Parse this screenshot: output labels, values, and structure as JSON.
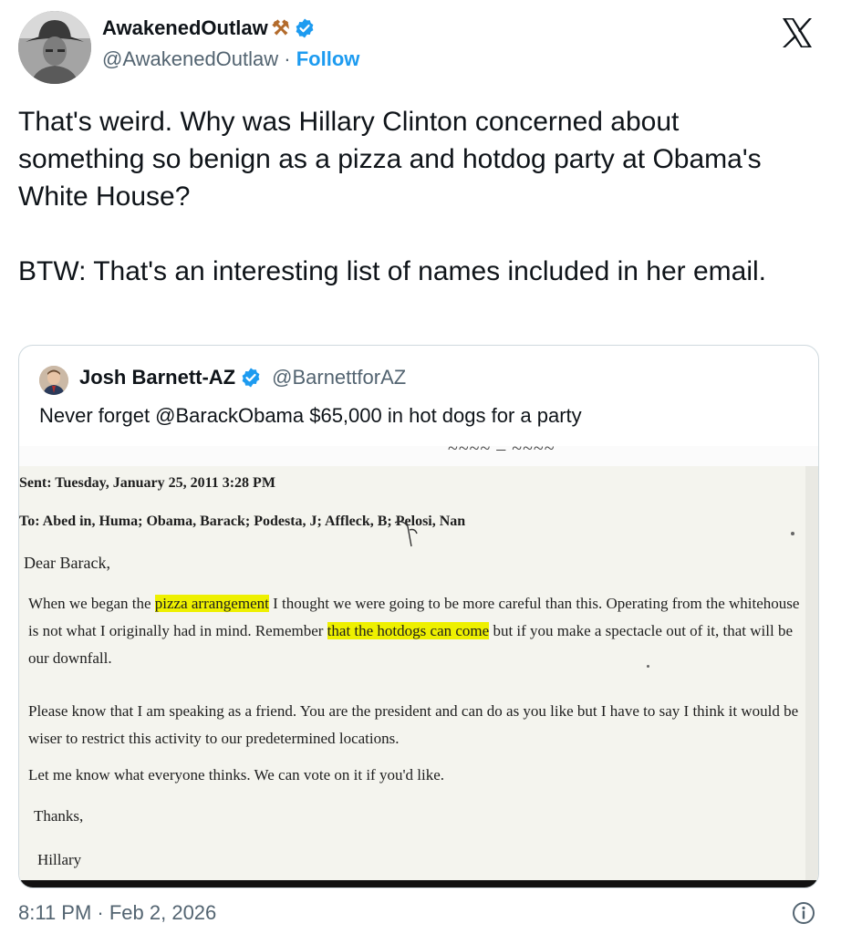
{
  "author": {
    "display_name": "AwakenedOutlaw",
    "name_emoji": "⚒",
    "handle": "@AwakenedOutlaw",
    "separator": "·",
    "follow_label": "Follow",
    "verified_color": "#1d9bf0"
  },
  "tweet": {
    "text": "That's weird.  Why was Hillary Clinton concerned about something so benign as a pizza and hotdog party at Obama's White House?\n\nBTW: That's an interesting list of names included in her email.",
    "timestamp": "8:11 PM · Feb 2, 2026"
  },
  "quote": {
    "display_name": "Josh Barnett-AZ",
    "handle": "@BarnettforAZ",
    "text": "Never forget @BarackObama $65,000 in hot dogs for a party"
  },
  "email": {
    "top_fragment": "~~~~  – ~~~~",
    "sent": "Sent: Tuesday, January 25, 2011 3:28 PM",
    "to": "To: Abed in, Huma; Obama, Barack; Podesta, J; Affleck, B; Pelosi, Nan",
    "greeting": "Dear Barack,",
    "p1_a": "When we began the ",
    "p1_hl1": "pizza arrangement",
    "p1_b": " I thought we were going to be more careful than this. Operating from the whitehouse is not what I originally had in mind. Remember ",
    "p1_hl2": "that the hotdogs can come",
    "p1_c": " but if you make a spectacle out of it, that will be our downfall.",
    "p2": "Please know that I am speaking as a friend. You are the president and can do as you like but I have to say I think it would be wiser to restrict this activity to our predetermined locations.",
    "p3": "Let me know what everyone thinks. We can vote on it if you'd like.",
    "closing": "Thanks,",
    "signature": "Hillary",
    "highlight_color": "#eef000"
  },
  "icons": {
    "brand": "x-logo-icon",
    "verified": "verified-badge-icon",
    "info": "info-icon"
  }
}
